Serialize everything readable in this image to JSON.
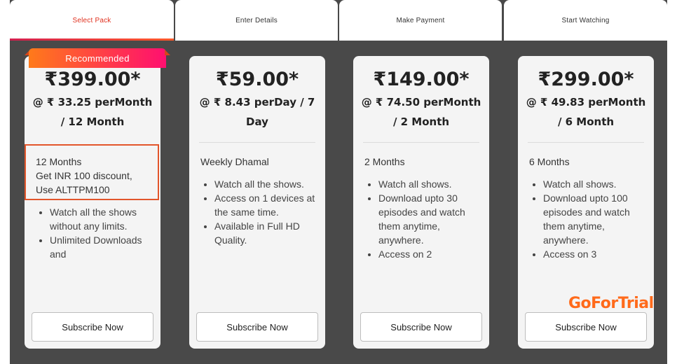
{
  "steps": [
    {
      "label": "Select Pack",
      "active": true
    },
    {
      "label": "Enter Details",
      "active": false
    },
    {
      "label": "Make Payment",
      "active": false
    },
    {
      "label": "Start Watching",
      "active": false
    }
  ],
  "plans": [
    {
      "badge": "Recommended",
      "price": "₹399.00*",
      "per_line1": "@ ₹ 33.25 perMonth",
      "per_line2": "/ 12 Month",
      "desc_lines": [
        "12 Months",
        "Get INR 100 discount,",
        "Use ALTTPM100"
      ],
      "features": [
        "Watch all the shows without any limits.",
        "Unlimited Downloads and"
      ],
      "button": "Subscribe Now"
    },
    {
      "price": "₹59.00*",
      "per_line1": "@ ₹ 8.43 perDay / 7",
      "per_line2": "Day",
      "desc_lines": [
        "Weekly Dhamal"
      ],
      "features": [
        "Watch all the shows.",
        "Access on 1 devices at the same time.",
        "Available in Full HD Quality."
      ],
      "button": "Subscribe Now"
    },
    {
      "price": "₹149.00*",
      "per_line1": "@ ₹ 74.50 perMonth",
      "per_line2": "/ 2 Month",
      "desc_lines": [
        "2 Months"
      ],
      "features": [
        "Watch all shows.",
        "Download upto 30 episodes and watch them anytime, anywhere.",
        "Access on 2"
      ],
      "button": "Subscribe Now"
    },
    {
      "price": "₹299.00*",
      "per_line1": "@ ₹ 49.83 perMonth",
      "per_line2": "/ 6 Month",
      "desc_lines": [
        "6 Months"
      ],
      "features": [
        "Watch all shows.",
        "Download upto 100 episodes and watch them anytime, anywhere.",
        "Access on 3"
      ],
      "button": "Subscribe Now"
    }
  ],
  "watermark": "GoForTrial",
  "colors": {
    "active_step": "#e0301e",
    "accent_start": "#ff7a1a",
    "accent_end": "#ff1070",
    "promo_border": "#e2552b"
  }
}
